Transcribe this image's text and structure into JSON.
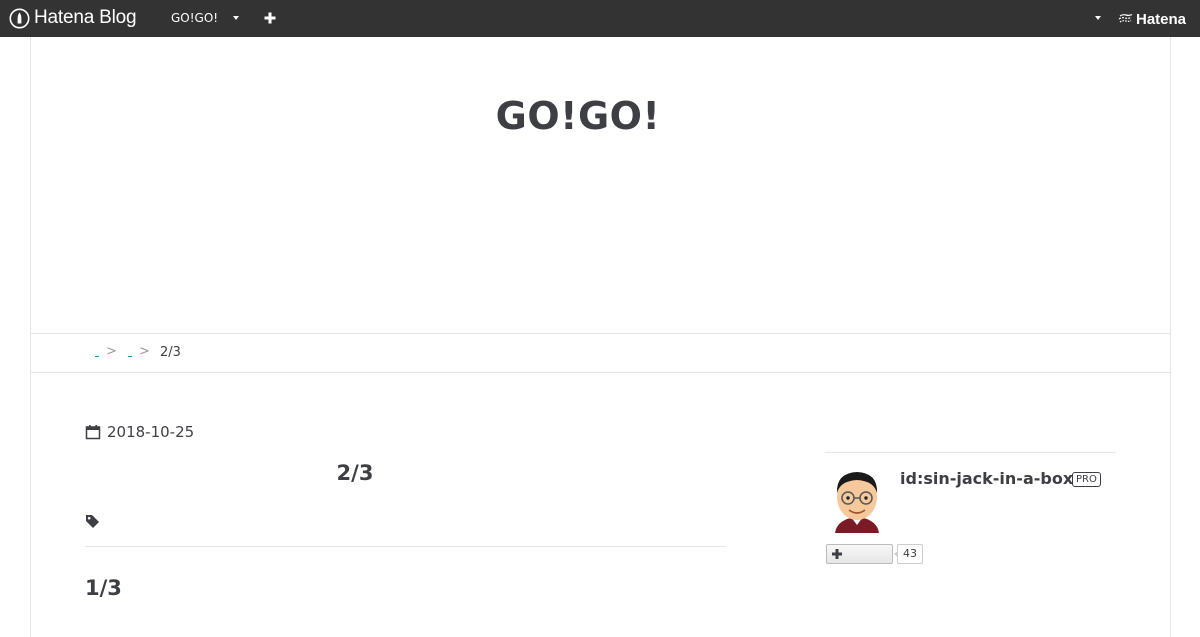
{
  "header": {
    "logo_text": "Hatena Blog",
    "blog_name": "GO!GO!",
    "hatena_text": "Hatena",
    "icons": [
      "hatena-blog-logo-icon",
      "caret-down-icon",
      "plus-icon",
      "hatena-logo-icon"
    ]
  },
  "blog": {
    "title": "GO!GO!"
  },
  "breadcrumb": {
    "separator": ">",
    "current": "2/3"
  },
  "entry": {
    "date": "2018-10-25",
    "title": "2/3",
    "section_heading": "1/3"
  },
  "profile": {
    "id": "id:sin-jack-in-a-box",
    "badge": "PRO",
    "subscribers": "43"
  },
  "colors": {
    "header_bg": "#333333",
    "text": "#3d3f44",
    "border": "#e6e6e6",
    "link": "#2a8fbd"
  }
}
